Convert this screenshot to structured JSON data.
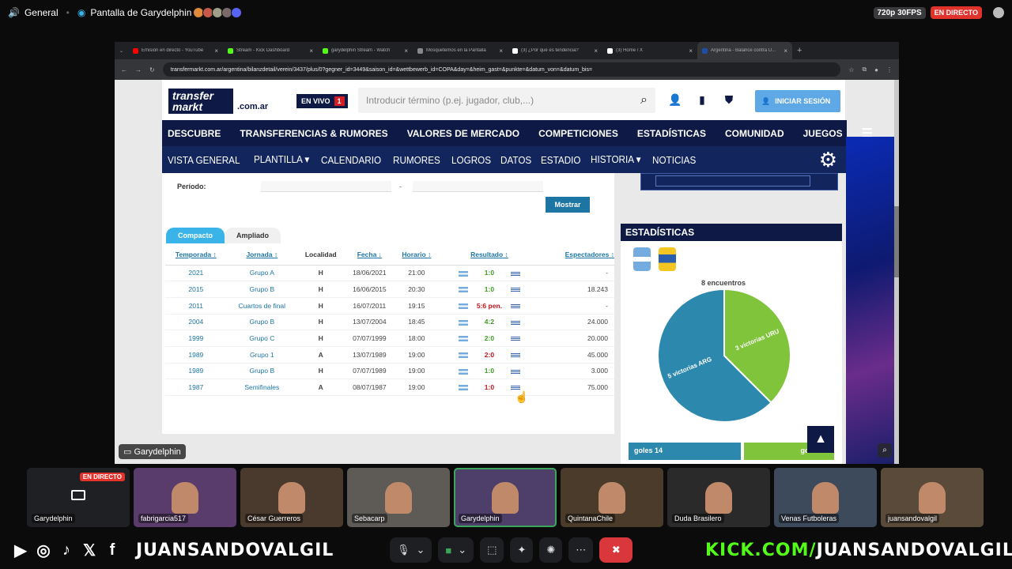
{
  "topbar": {
    "channel": "General",
    "stream_title": "Pantalla de Garydelphin",
    "resolution": "720p 30FPS",
    "live_badge": "EN DIRECTO"
  },
  "browser": {
    "tabs": [
      {
        "label": "Emisión en directo - YouTube",
        "color": "#ff0000"
      },
      {
        "label": "Stream - Kick Dashboard",
        "color": "#53fc18"
      },
      {
        "label": "garydelphin Stream - Watch",
        "color": "#53fc18"
      },
      {
        "label": "Mosquetemos en la Pantalla",
        "color": "#888888"
      },
      {
        "label": "(3) ¿Por qué es tendencia?",
        "color": "#ffffff"
      },
      {
        "label": "(3) Home / X",
        "color": "#ffffff"
      },
      {
        "label": "Argentina - Balance contra U...",
        "color": "#1d4fa8"
      }
    ],
    "url": "transfermarkt.com.ar/argentina/bilanzdetail/verein/3437/plus/0?gegner_id=3449&saison_id=&wettbewerb_id=COPA&day=&heim_gast=&punkte=&datum_von=&datum_bis="
  },
  "tm": {
    "logo_line1": "transfer",
    "logo_line2": "markt",
    "logo_domain": ".com.ar",
    "envivo_label": "EN VIVO",
    "envivo_count": "1",
    "search_placeholder": "Introducir término (p.ej. jugador, club,...)",
    "login_label": "INICIAR SESIÓN",
    "main_nav": [
      "DESCUBRE",
      "TRANSFERENCIAS & RUMORES",
      "VALORES DE MERCADO",
      "COMPETICIONES",
      "ESTADÍSTICAS",
      "COMUNIDAD",
      "JUEGOS"
    ],
    "sub_nav": [
      "VISTA GENERAL",
      "PLANTILLA ▾",
      "CALENDARIO",
      "RUMORES",
      "LOGROS",
      "DATOS",
      "ESTADIO",
      "HISTORIA ▾",
      "NOTICIAS"
    ],
    "periodo_label": "Período:",
    "periodo_sep": "-",
    "mostrar_label": "Mostrar",
    "view_tabs": [
      "Compacto",
      "Ampliado"
    ],
    "columns": [
      "Temporada ↕",
      "Jornada ↕",
      "Localidad",
      "Fecha ↓",
      "Horario ↕",
      "Resultado ↕",
      "Espectadores ↕"
    ],
    "rows": [
      {
        "season": "2021",
        "round": "Grupo A",
        "loc": "H",
        "date": "18/06/2021",
        "time": "21:00",
        "result": "1:0",
        "outcome": "win",
        "attendance": "-"
      },
      {
        "season": "2015",
        "round": "Grupo B",
        "loc": "H",
        "date": "16/06/2015",
        "time": "20:30",
        "result": "1:0",
        "outcome": "win",
        "attendance": "18.243"
      },
      {
        "season": "2011",
        "round": "Cuartos de final",
        "loc": "H",
        "date": "16/07/2011",
        "time": "19:15",
        "result": "5:6 pen.",
        "outcome": "loss",
        "attendance": "-"
      },
      {
        "season": "2004",
        "round": "Grupo B",
        "loc": "H",
        "date": "13/07/2004",
        "time": "18:45",
        "result": "4:2",
        "outcome": "win",
        "attendance": "24.000"
      },
      {
        "season": "1999",
        "round": "Grupo C",
        "loc": "H",
        "date": "07/07/1999",
        "time": "18:00",
        "result": "2:0",
        "outcome": "win",
        "attendance": "20.000"
      },
      {
        "season": "1989",
        "round": "Grupo 1",
        "loc": "A",
        "date": "13/07/1989",
        "time": "19:00",
        "result": "2:0",
        "outcome": "loss",
        "attendance": "45.000"
      },
      {
        "season": "1989",
        "round": "Grupo B",
        "loc": "H",
        "date": "07/07/1989",
        "time": "19:00",
        "result": "1:0",
        "outcome": "win",
        "attendance": "3.000"
      },
      {
        "season": "1987",
        "round": "Semifinales",
        "loc": "A",
        "date": "08/07/1987",
        "time": "19:00",
        "result": "1:0",
        "outcome": "loss",
        "attendance": "75.000"
      }
    ],
    "stats_title": "ESTADÍSTICAS",
    "encuentros": "8 encuentros",
    "pie": [
      {
        "label": "5 victorias ARG",
        "value": 5,
        "color": "#2c88ad"
      },
      {
        "label": "3 victorias URU",
        "value": 3,
        "color": "#7fc43a"
      }
    ],
    "goles_arg": "goles 14",
    "goles_uru": "goles 11",
    "colors": {
      "navy": "#0e1a45",
      "link": "#1d75a3",
      "win": "#3e9c22",
      "loss": "#c0141b"
    }
  },
  "stream": {
    "screen_label": "Garydelphin",
    "participants": [
      {
        "name": "Garydelphin",
        "live": "EN DIRECTO",
        "screen": true
      },
      {
        "name": "fabrigarcia517"
      },
      {
        "name": "César Guerreros"
      },
      {
        "name": "Sebacarp"
      },
      {
        "name": "Garydelphin",
        "selected": true
      },
      {
        "name": "QuintanaChile"
      },
      {
        "name": "Duda Brasilero"
      },
      {
        "name": "Venas Futboleras"
      },
      {
        "name": "juansandovalgil"
      }
    ],
    "handle": "JUANSANDOVALGIL",
    "kick_prefix": "KICK.COM/",
    "kick_handle": "JUANSANDOVALGIL"
  }
}
